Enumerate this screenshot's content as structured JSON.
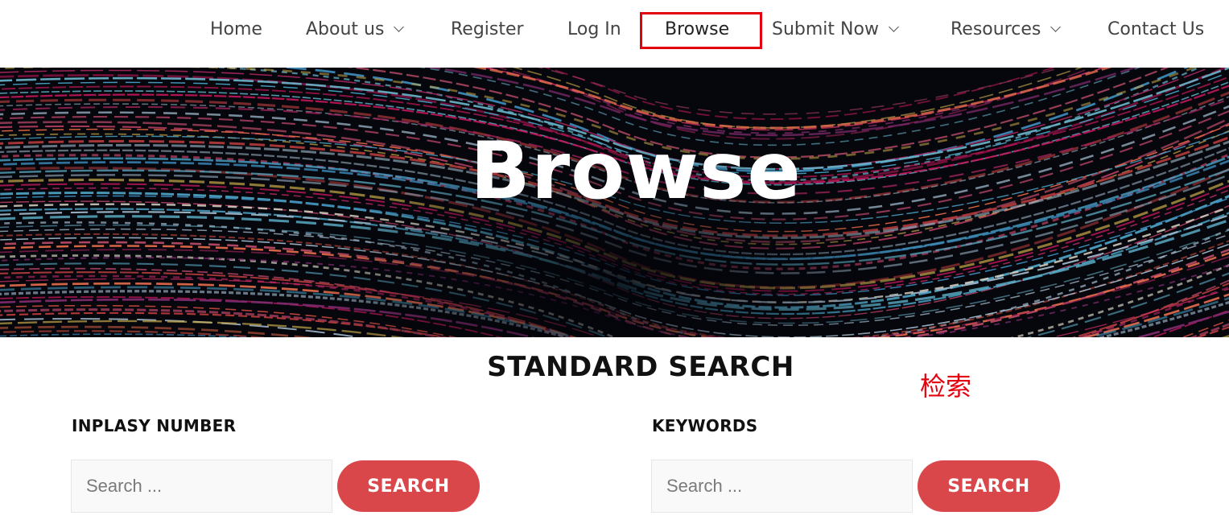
{
  "nav": {
    "items": [
      {
        "label": "Home",
        "has_dropdown": false
      },
      {
        "label": "About us",
        "has_dropdown": true
      },
      {
        "label": "Register",
        "has_dropdown": false
      },
      {
        "label": "Log In",
        "has_dropdown": false
      },
      {
        "label": "Browse",
        "has_dropdown": false,
        "active": true
      },
      {
        "label": "Submit Now",
        "has_dropdown": true
      },
      {
        "label": "Resources",
        "has_dropdown": true
      },
      {
        "label": "Contact Us",
        "has_dropdown": false
      }
    ],
    "highlight_color": "#e3000f"
  },
  "hero": {
    "title": "Browse"
  },
  "search_section": {
    "title": "STANDARD SEARCH",
    "annotation": "检索",
    "annotation_color": "#e3000f",
    "fields": [
      {
        "label": "INPLASY NUMBER",
        "placeholder": "Search ...",
        "button": "SEARCH"
      },
      {
        "label": "KEYWORDS",
        "placeholder": "Search ...",
        "button": "SEARCH"
      }
    ],
    "button_color": "#d9474a"
  }
}
